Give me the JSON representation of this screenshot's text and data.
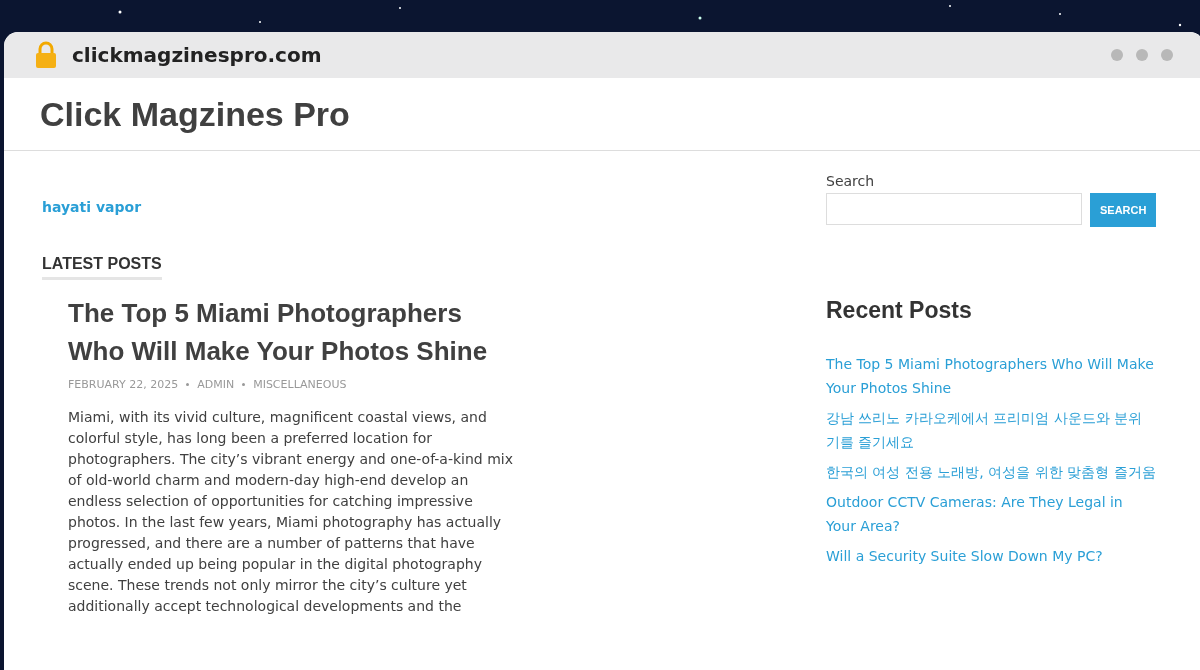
{
  "browser": {
    "url": "clickmagzinespro.com"
  },
  "site": {
    "title": "Click Magzines Pro"
  },
  "top_link": "hayati vapor",
  "section_heading": "LATEST POSTS",
  "post": {
    "title": "The Top 5 Miami Photographers Who Will Make Your Photos Shine",
    "meta": [
      "FEBRUARY 22, 2025",
      "ADMIN",
      "MISCELLANEOUS"
    ],
    "body": "Miami, with its vivid culture, magnificent coastal views, and colorful style, has long been a preferred location for photographers. The city’s vibrant energy and one-of-a-kind mix of old-world charm and modern-day high-end develop an endless selection of opportunities for catching impressive photos. In the last few years, Miami photography has actually progressed, and there are a number of patterns that have actually ended up being popular in the digital photography scene. These trends not only mirror the city’s culture yet additionally accept technological developments and the"
  },
  "sidebar": {
    "search_label": "Search",
    "search_button": "SEARCH",
    "recent_heading": "Recent Posts",
    "recent_posts": [
      "The Top 5 Miami Photographers Who Will Make Your Photos Shine",
      "강남 쓰리노 카라오케에서 프리미엄 사운드와 분위기를 즐기세요",
      "한국의 여성 전용 노래방, 여성을 위한 맞춤형 즐거움",
      "Outdoor CCTV Cameras: Are They Legal in Your Area?",
      "Will a Security Suite Slow Down My PC?"
    ]
  }
}
